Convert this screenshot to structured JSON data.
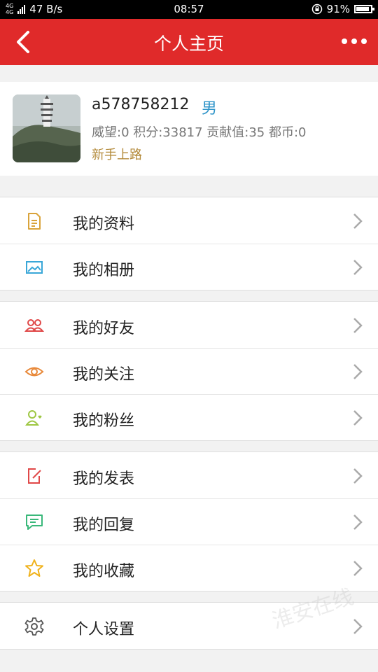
{
  "status_bar": {
    "network": "4G",
    "network2": "4G",
    "speed": "47 B/s",
    "time": "08:57",
    "battery": "91%",
    "battery_level": 0.91
  },
  "header": {
    "title": "个人主页",
    "back_icon": "back-arrow-icon",
    "more_icon": "more-icon"
  },
  "profile": {
    "username": "a578758212",
    "gender": "男",
    "stats": "威望:0 积分:33817 贡献值:35 都币:0",
    "level": "新手上路",
    "avatar_icon": "avatar-pagoda-photo"
  },
  "menu": {
    "my_profile": "我的资料",
    "my_album": "我的相册",
    "my_friends": "我的好友",
    "my_following": "我的关注",
    "my_fans": "我的粉丝",
    "my_posts": "我的发表",
    "my_replies": "我的回复",
    "my_favorites": "我的收藏",
    "settings": "个人设置"
  },
  "watermark": "淮安在线",
  "colors": {
    "brand": "#e02a2a",
    "gender": "#2c93c8",
    "level": "#b38a3a"
  }
}
